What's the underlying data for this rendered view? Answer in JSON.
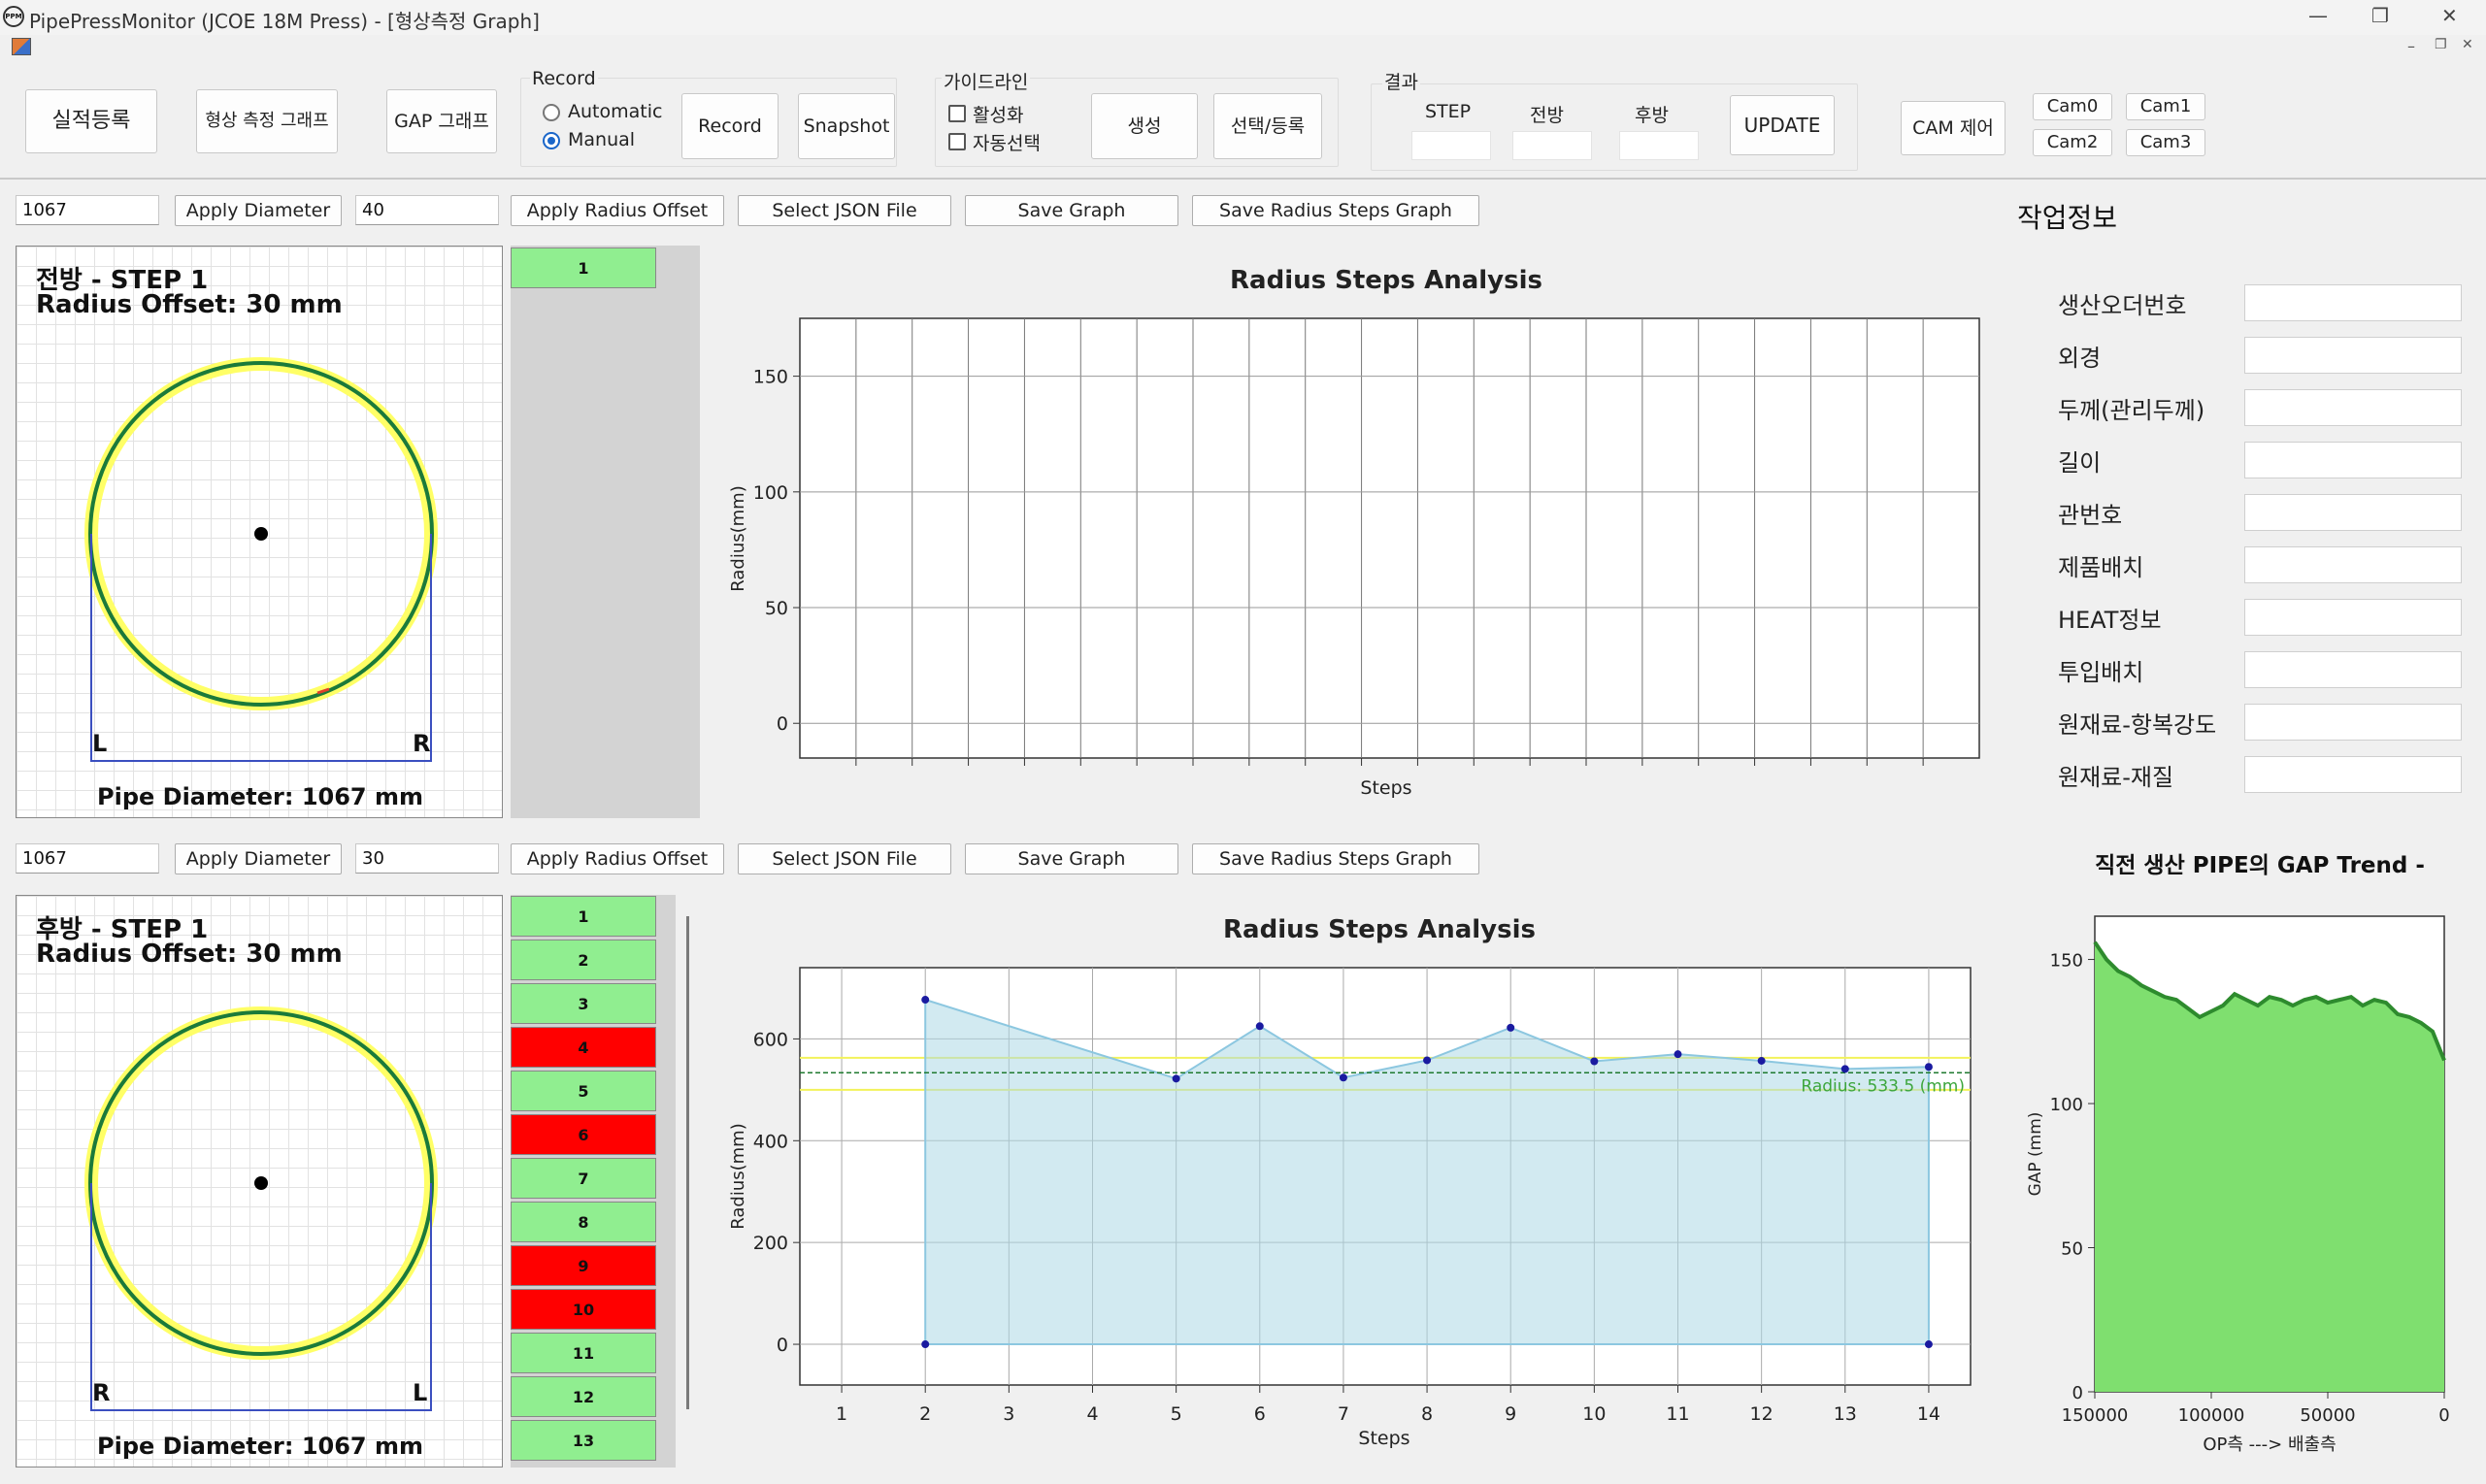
{
  "window": {
    "title": "PipePressMonitor (JCOE 18M Press) - [형상측정 Graph]",
    "icon_text": "PPM",
    "minimize": "—",
    "restore": "❐",
    "close": "✕",
    "mdi_min": "–",
    "mdi_restore": "❐",
    "mdi_close": "✕"
  },
  "toolbar": {
    "btn_results": "실적등록",
    "btn_shape_graph": "형상 측정 그래프",
    "btn_gap_graph": "GAP 그래프",
    "record_group": "Record",
    "radio_auto": "Automatic",
    "radio_manual": "Manual",
    "radio_selected": "Manual",
    "btn_record": "Record",
    "btn_snapshot": "Snapshot",
    "guide_group": "가이드라인",
    "chk_activate": "활성화",
    "chk_autoselect": "자동선택",
    "btn_create": "생성",
    "btn_select_register": "선택/등록",
    "result_group": "결과",
    "lbl_step": "STEP",
    "lbl_front": "전방",
    "lbl_back": "후방",
    "btn_update": "UPDATE",
    "btn_cam_control": "CAM 제어",
    "btn_cam0": "Cam0",
    "btn_cam1": "Cam1",
    "btn_cam2": "Cam2",
    "btn_cam3": "Cam3"
  },
  "front": {
    "diameter_input": "1067",
    "apply_diameter": "Apply Diameter",
    "offset_input": "40",
    "apply_offset": "Apply Radius Offset",
    "select_json": "Select JSON File",
    "save_graph": "Save Graph",
    "save_steps_graph": "Save Radius Steps Graph",
    "title_line1": "전방 - STEP 1",
    "title_line2": "Radius Offset: 30 mm",
    "left_mark": "L",
    "right_mark": "R",
    "diameter_text": "Pipe Diameter: 1067 mm",
    "steps": [
      {
        "label": "1",
        "status": "ok"
      }
    ]
  },
  "back": {
    "diameter_input": "1067",
    "apply_diameter": "Apply Diameter",
    "offset_input": "30",
    "apply_offset": "Apply Radius Offset",
    "select_json": "Select JSON File",
    "save_graph": "Save Graph",
    "save_steps_graph": "Save Radius Steps Graph",
    "title_line1": "후방 - STEP 1",
    "title_line2": "Radius Offset: 30 mm",
    "left_mark": "R",
    "right_mark": "L",
    "diameter_text": "Pipe Diameter: 1067 mm",
    "steps": [
      {
        "label": "1",
        "status": "ok"
      },
      {
        "label": "2",
        "status": "ok"
      },
      {
        "label": "3",
        "status": "ok"
      },
      {
        "label": "4",
        "status": "ng"
      },
      {
        "label": "5",
        "status": "ok"
      },
      {
        "label": "6",
        "status": "ng"
      },
      {
        "label": "7",
        "status": "ok"
      },
      {
        "label": "8",
        "status": "ok"
      },
      {
        "label": "9",
        "status": "ng"
      },
      {
        "label": "10",
        "status": "ng"
      },
      {
        "label": "11",
        "status": "ok"
      },
      {
        "label": "12",
        "status": "ok"
      },
      {
        "label": "13",
        "status": "ok"
      }
    ]
  },
  "colors": {
    "ok": "#90ee90",
    "ng": "#ff0000",
    "pipe_ring": "#ffff66",
    "pipe_line": "#1b7a3a",
    "chart_fill": "#add8e6",
    "gap_fill": "#7fdf6f",
    "gap_line": "#2e8b2e"
  },
  "info": {
    "title": "작업정보",
    "fields": [
      "생산오더번호",
      "외경",
      "두께(관리두께)",
      "길이",
      "관번호",
      "제품배치",
      "HEAT정보",
      "투입배치",
      "원재료-항복강도",
      "원재료-재질"
    ]
  },
  "gap_title": "직전 생산 PIPE의 GAP Trend -",
  "chart_data": [
    {
      "type": "line",
      "title": "Radius Steps Analysis",
      "xlabel": "Steps",
      "ylabel": "Radius(mm)",
      "ylim": [
        -15,
        175
      ],
      "yticks": [
        0,
        50,
        100,
        150
      ],
      "x": [],
      "series": [],
      "grid": true
    },
    {
      "type": "area",
      "title": "Radius Steps Analysis",
      "xlabel": "Steps",
      "ylabel": "Radius(mm)",
      "xlim": [
        0.5,
        14.5
      ],
      "ylim": [
        -80,
        740
      ],
      "xticks": [
        1,
        2,
        3,
        4,
        5,
        6,
        7,
        8,
        9,
        10,
        11,
        12,
        13,
        14
      ],
      "yticks": [
        0,
        200,
        400,
        600
      ],
      "x": [
        2,
        2,
        5,
        6,
        7,
        8,
        9,
        10,
        11,
        12,
        13,
        14,
        14
      ],
      "y": [
        0,
        677,
        522,
        625,
        524,
        558,
        622,
        556,
        570,
        557,
        541,
        545,
        0
      ],
      "reference_line": {
        "value": 533.5,
        "label": "Radius: 533.5 (mm)"
      },
      "tolerance_band": [
        500,
        563
      ],
      "grid": true
    },
    {
      "type": "area",
      "title": "직전 생산 PIPE의 GAP Trend -",
      "xlabel": "OP측 ---> 배출측",
      "ylabel": "GAP (mm)",
      "xlim": [
        150000,
        0
      ],
      "ylim": [
        0,
        165
      ],
      "xticks": [
        150000,
        100000,
        50000,
        0
      ],
      "yticks": [
        0,
        50,
        100,
        150
      ],
      "x": [
        150000,
        145000,
        140000,
        135000,
        130000,
        125000,
        120000,
        115000,
        110000,
        105000,
        100000,
        95000,
        90000,
        85000,
        80000,
        75000,
        70000,
        65000,
        60000,
        55000,
        50000,
        45000,
        40000,
        35000,
        30000,
        25000,
        20000,
        15000,
        10000,
        5000,
        0
      ],
      "y": [
        156,
        150,
        146,
        144,
        141,
        139,
        137,
        136,
        133,
        130,
        132,
        134,
        138,
        136,
        134,
        137,
        136,
        134,
        136,
        137,
        135,
        136,
        137,
        134,
        136,
        135,
        131,
        130,
        128,
        125,
        115
      ],
      "grid": false
    }
  ]
}
